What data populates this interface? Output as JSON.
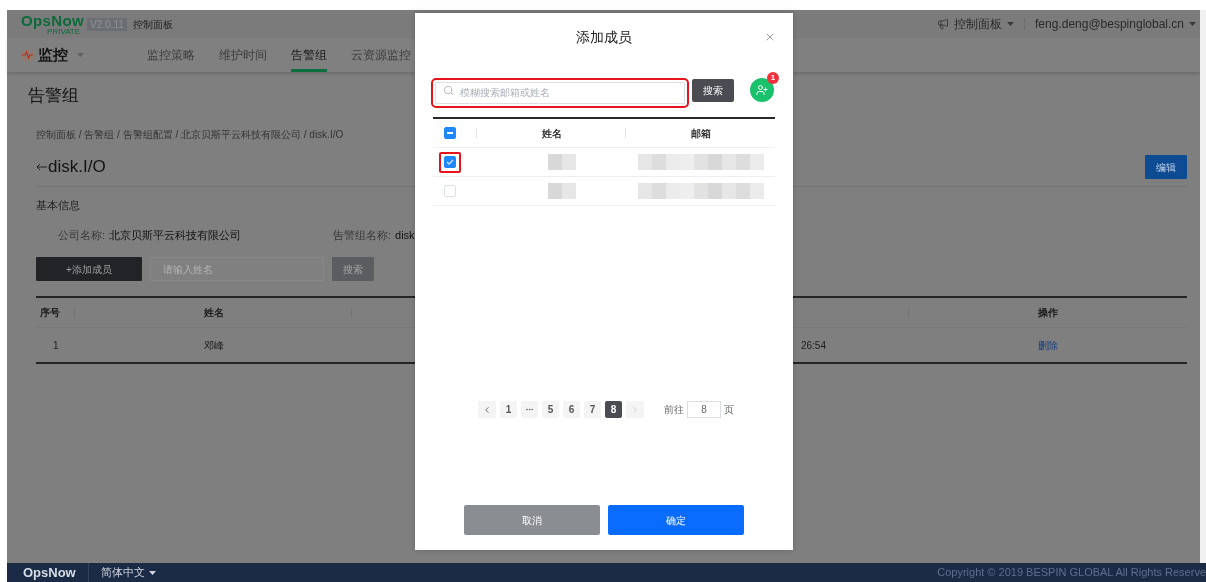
{
  "header": {
    "logo": "OpsNow",
    "logo_sub": "PRIVATE",
    "version": "V2.0.11",
    "location": "控制面板",
    "menu": "控制面板",
    "user": "feng.deng@bespinglobal.cn"
  },
  "nav": {
    "section": "监控",
    "tabs": [
      {
        "label": "监控策略",
        "selected": false
      },
      {
        "label": "维护时间",
        "selected": false
      },
      {
        "label": "告警组",
        "selected": true
      },
      {
        "label": "云资源监控",
        "selected": false
      }
    ]
  },
  "page": {
    "title": "告警组",
    "breadcrumb": "控制面板 / 告警组 / 告警组配置 / 北京贝斯平云科技有限公司 / disk.I/O",
    "group_title": "disk.I/O",
    "edit_button": "编辑",
    "section": "基本信息",
    "fields": [
      {
        "label": "公司名称:",
        "value": "北京贝斯平云科技有限公司"
      },
      {
        "label": "告警组名称:",
        "value": "disk"
      }
    ],
    "add_button": "+添加成员",
    "name_placeholder": "请输入姓名",
    "search_button": "搜索",
    "table": {
      "columns": [
        "序号",
        "姓名",
        "操作"
      ],
      "rows": [
        {
          "index": "1",
          "name": "邓峰",
          "column_4": "26:54",
          "action": "删除"
        }
      ]
    }
  },
  "modal": {
    "title": "添加成员",
    "search": {
      "placeholder": "模糊搜索邮箱或姓名",
      "highlighted": true
    },
    "search_button": "搜索",
    "badge": "1",
    "select_all": {
      "indeterminate": true
    },
    "columns": [
      "姓名",
      "邮箱"
    ],
    "rows": [
      {
        "checked": true,
        "highlighted": true
      },
      {
        "checked": false,
        "highlighted": false
      }
    ],
    "pagination": {
      "prev_disabled": false,
      "next_disabled": true,
      "pages": [
        {
          "kind": "page",
          "label": "1",
          "selected": false
        },
        {
          "kind": "ellipsis",
          "selected": false
        },
        {
          "kind": "page",
          "label": "5",
          "selected": false
        },
        {
          "kind": "page",
          "label": "6",
          "selected": false
        },
        {
          "kind": "page",
          "label": "7",
          "selected": false
        },
        {
          "kind": "page",
          "label": "8",
          "selected": true
        }
      ],
      "jump_label": "前往",
      "jump_value": "8",
      "jump_suffix": "页"
    },
    "cancel_button": "取消",
    "confirm_button": "确定"
  },
  "footer": {
    "brand": "OpsNow",
    "language": "简体中文",
    "copyright": "Copyright © 2019 BESPIN GLOBAL All Rights Reserve"
  }
}
